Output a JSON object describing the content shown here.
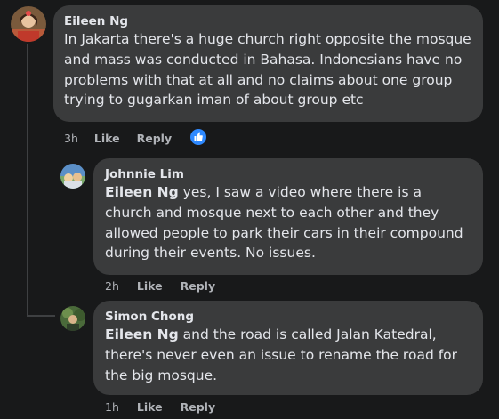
{
  "comments": [
    {
      "author": "Eileen Ng",
      "mention": "",
      "text": "In Jakarta there's a huge church right opposite the mosque and mass was conducted in Bahasa. Indonesians have no problems with that at all and no claims about one group trying to gugarkan iman of about group etc",
      "time": "3h",
      "like": "Like",
      "reply": "Reply",
      "reaction": "like-reaction-icon"
    },
    {
      "author": "Johnnie Lim",
      "mention": "Eileen Ng",
      "text": " yes, I saw a video where there is a church and mosque next to each other and they allowed people to park their cars in their compound during their events. No issues.",
      "time": "2h",
      "like": "Like",
      "reply": "Reply"
    },
    {
      "author": "Simon Chong",
      "mention": "Eileen Ng",
      "text": " and the road is called Jalan Katedral, there's never even an issue to rename the road for the big mosque.",
      "time": "1h",
      "like": "Like",
      "reply": "Reply"
    }
  ],
  "colors": {
    "background": "#18191a",
    "bubble": "#3a3b3c",
    "text": "#e4e6eb",
    "secondary": "#b0b3b8",
    "like_blue": "#2e89ff"
  }
}
